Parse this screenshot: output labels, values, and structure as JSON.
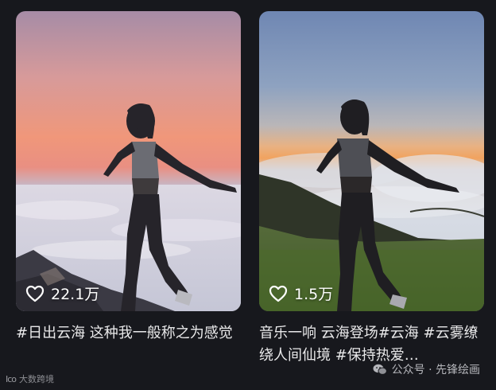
{
  "cards": [
    {
      "likes": "22.1万",
      "caption": "#日出云海 这种我一般称之为感觉"
    },
    {
      "likes": "1.5万",
      "caption": "音乐一响 云海登场#云海 #云雾缭绕人间仙境 #保持热爱…"
    }
  ],
  "watermark_left": {
    "logo": "Ico",
    "text": "大数跨境"
  },
  "watermark_right": {
    "text": "公众号 · 先锋绘画"
  },
  "icons": {
    "like": "heart-icon",
    "brand": "wechat-icon"
  },
  "colors": {
    "background": "#17181d",
    "caption": "#e9e9ea",
    "likes": "#ffffff"
  }
}
